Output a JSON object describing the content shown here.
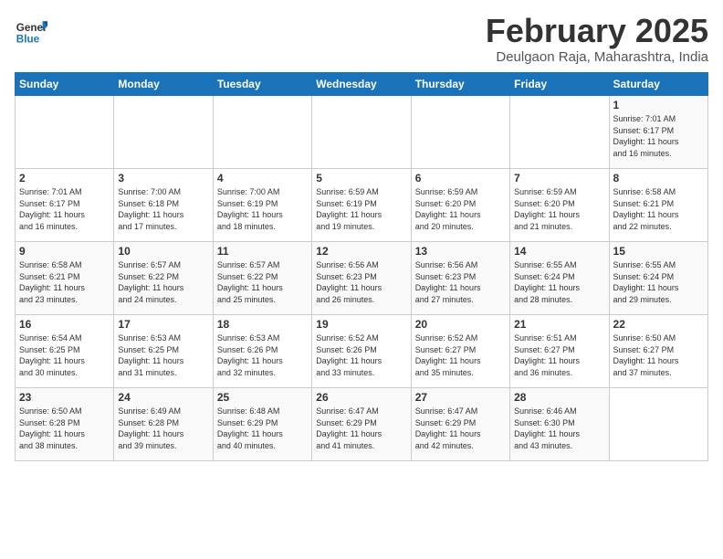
{
  "header": {
    "logo_line1": "General",
    "logo_line2": "Blue",
    "title": "February 2025",
    "subtitle": "Deulgaon Raja, Maharashtra, India"
  },
  "days_of_week": [
    "Sunday",
    "Monday",
    "Tuesday",
    "Wednesday",
    "Thursday",
    "Friday",
    "Saturday"
  ],
  "weeks": [
    [
      {
        "day": "",
        "info": ""
      },
      {
        "day": "",
        "info": ""
      },
      {
        "day": "",
        "info": ""
      },
      {
        "day": "",
        "info": ""
      },
      {
        "day": "",
        "info": ""
      },
      {
        "day": "",
        "info": ""
      },
      {
        "day": "1",
        "info": "Sunrise: 7:01 AM\nSunset: 6:17 PM\nDaylight: 11 hours\nand 16 minutes."
      }
    ],
    [
      {
        "day": "2",
        "info": "Sunrise: 7:01 AM\nSunset: 6:17 PM\nDaylight: 11 hours\nand 16 minutes."
      },
      {
        "day": "3",
        "info": "Sunrise: 7:00 AM\nSunset: 6:18 PM\nDaylight: 11 hours\nand 17 minutes."
      },
      {
        "day": "4",
        "info": "Sunrise: 7:00 AM\nSunset: 6:19 PM\nDaylight: 11 hours\nand 18 minutes."
      },
      {
        "day": "5",
        "info": "Sunrise: 6:59 AM\nSunset: 6:19 PM\nDaylight: 11 hours\nand 19 minutes."
      },
      {
        "day": "6",
        "info": "Sunrise: 6:59 AM\nSunset: 6:20 PM\nDaylight: 11 hours\nand 20 minutes."
      },
      {
        "day": "7",
        "info": "Sunrise: 6:59 AM\nSunset: 6:20 PM\nDaylight: 11 hours\nand 21 minutes."
      },
      {
        "day": "8",
        "info": "Sunrise: 6:58 AM\nSunset: 6:21 PM\nDaylight: 11 hours\nand 22 minutes."
      }
    ],
    [
      {
        "day": "9",
        "info": "Sunrise: 6:58 AM\nSunset: 6:21 PM\nDaylight: 11 hours\nand 23 minutes."
      },
      {
        "day": "10",
        "info": "Sunrise: 6:57 AM\nSunset: 6:22 PM\nDaylight: 11 hours\nand 24 minutes."
      },
      {
        "day": "11",
        "info": "Sunrise: 6:57 AM\nSunset: 6:22 PM\nDaylight: 11 hours\nand 25 minutes."
      },
      {
        "day": "12",
        "info": "Sunrise: 6:56 AM\nSunset: 6:23 PM\nDaylight: 11 hours\nand 26 minutes."
      },
      {
        "day": "13",
        "info": "Sunrise: 6:56 AM\nSunset: 6:23 PM\nDaylight: 11 hours\nand 27 minutes."
      },
      {
        "day": "14",
        "info": "Sunrise: 6:55 AM\nSunset: 6:24 PM\nDaylight: 11 hours\nand 28 minutes."
      },
      {
        "day": "15",
        "info": "Sunrise: 6:55 AM\nSunset: 6:24 PM\nDaylight: 11 hours\nand 29 minutes."
      }
    ],
    [
      {
        "day": "16",
        "info": "Sunrise: 6:54 AM\nSunset: 6:25 PM\nDaylight: 11 hours\nand 30 minutes."
      },
      {
        "day": "17",
        "info": "Sunrise: 6:53 AM\nSunset: 6:25 PM\nDaylight: 11 hours\nand 31 minutes."
      },
      {
        "day": "18",
        "info": "Sunrise: 6:53 AM\nSunset: 6:26 PM\nDaylight: 11 hours\nand 32 minutes."
      },
      {
        "day": "19",
        "info": "Sunrise: 6:52 AM\nSunset: 6:26 PM\nDaylight: 11 hours\nand 33 minutes."
      },
      {
        "day": "20",
        "info": "Sunrise: 6:52 AM\nSunset: 6:27 PM\nDaylight: 11 hours\nand 35 minutes."
      },
      {
        "day": "21",
        "info": "Sunrise: 6:51 AM\nSunset: 6:27 PM\nDaylight: 11 hours\nand 36 minutes."
      },
      {
        "day": "22",
        "info": "Sunrise: 6:50 AM\nSunset: 6:27 PM\nDaylight: 11 hours\nand 37 minutes."
      }
    ],
    [
      {
        "day": "23",
        "info": "Sunrise: 6:50 AM\nSunset: 6:28 PM\nDaylight: 11 hours\nand 38 minutes."
      },
      {
        "day": "24",
        "info": "Sunrise: 6:49 AM\nSunset: 6:28 PM\nDaylight: 11 hours\nand 39 minutes."
      },
      {
        "day": "25",
        "info": "Sunrise: 6:48 AM\nSunset: 6:29 PM\nDaylight: 11 hours\nand 40 minutes."
      },
      {
        "day": "26",
        "info": "Sunrise: 6:47 AM\nSunset: 6:29 PM\nDaylight: 11 hours\nand 41 minutes."
      },
      {
        "day": "27",
        "info": "Sunrise: 6:47 AM\nSunset: 6:29 PM\nDaylight: 11 hours\nand 42 minutes."
      },
      {
        "day": "28",
        "info": "Sunrise: 6:46 AM\nSunset: 6:30 PM\nDaylight: 11 hours\nand 43 minutes."
      },
      {
        "day": "",
        "info": ""
      }
    ]
  ]
}
